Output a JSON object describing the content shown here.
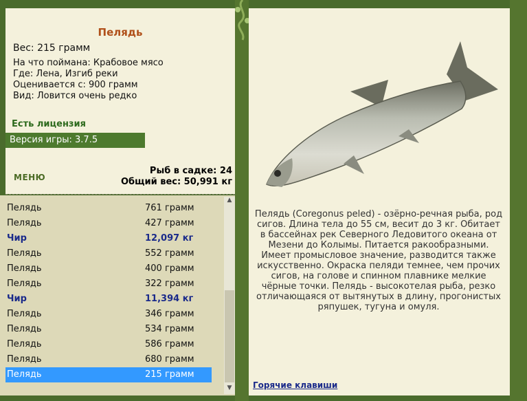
{
  "fish": {
    "name": "Пелядь",
    "weight": "Вес: 215 грамм",
    "bait": "На что поймана: Крабовое мясо",
    "place": "Где: Лена, Изгиб реки",
    "price_from": "Оценивается с: 900 грамм",
    "kind": "Вид: Ловится очень редко"
  },
  "license": "Есть лицензия",
  "version": "Версия игры: 3.7.5",
  "menu_label": "МЕНЮ",
  "totals": {
    "count": "Рыб в садке: 24",
    "weight": "Общий вес: 50,991 кг"
  },
  "catch_list": [
    {
      "name": "Пелядь",
      "weight": "761 грамм",
      "type": "normal"
    },
    {
      "name": "Пелядь",
      "weight": "427 грамм",
      "type": "normal"
    },
    {
      "name": "Чир",
      "weight": "12,097 кг",
      "type": "big"
    },
    {
      "name": "Пелядь",
      "weight": "552 грамм",
      "type": "normal"
    },
    {
      "name": "Пелядь",
      "weight": "400 грамм",
      "type": "normal"
    },
    {
      "name": "Пелядь",
      "weight": "322 грамм",
      "type": "normal"
    },
    {
      "name": "Чир",
      "weight": "11,394 кг",
      "type": "big"
    },
    {
      "name": "Пелядь",
      "weight": "346 грамм",
      "type": "normal"
    },
    {
      "name": "Пелядь",
      "weight": "534 грамм",
      "type": "normal"
    },
    {
      "name": "Пелядь",
      "weight": "586 грамм",
      "type": "normal"
    },
    {
      "name": "Пелядь",
      "weight": "680 грамм",
      "type": "normal"
    },
    {
      "name": "Пелядь",
      "weight": "215 грамм",
      "type": "selected"
    }
  ],
  "description": "Пелядь (Coregonus peled) - озёрно-речная рыба, род сигов. Длина тела до 55 см, весит до 3 кг. Обитает в бассейнах рек Северного Ледовитого океана от Мезени до Колымы. Питается ракообразными. Имеет промысловое значение, разводится также искусственно. Окраска пеляди темнее, чем прочих сигов, на голове и спинном плавнике мелкие чёрные точки. Пелядь - высокотелая рыба, резко отличающаяся от вытянутых в длину, прогонистых ряпушек, тугуна и омуля.",
  "hotkeys": "Горячие клавиши",
  "colors": {
    "title": "#b0501a",
    "license": "#2d6a1d",
    "big_catch": "#1a2a8a",
    "selection": "#3399ff",
    "frame": "#5b7a33"
  }
}
